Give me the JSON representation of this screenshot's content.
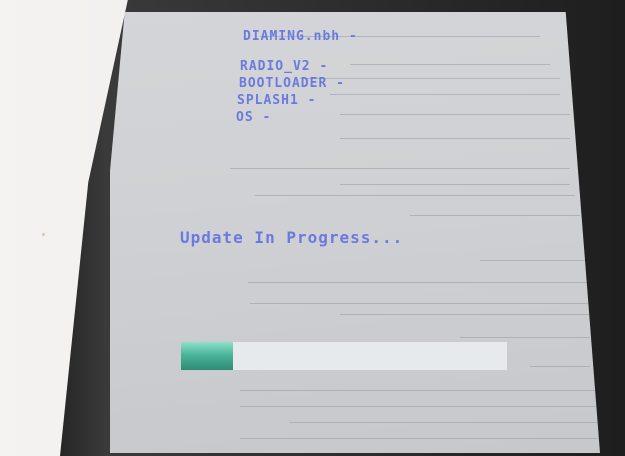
{
  "screen": {
    "file_name": "DIAMING.nbh -",
    "components": [
      "RADIO_V2 -",
      "BOOTLOADER -",
      "SPLASH1 -",
      "OS  -"
    ],
    "status_text": "Update In Progress...",
    "progress": {
      "fraction": 0.16,
      "fill_color": "#4bb59a",
      "track_color": "#e7eaed"
    },
    "text_color": "#6b7ae0"
  }
}
